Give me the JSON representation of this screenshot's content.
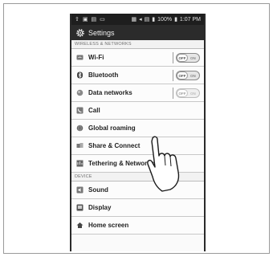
{
  "statusbar": {
    "left_icons": [
      "upload-icon",
      "image-icon",
      "sim-icon",
      "voicemail-icon"
    ],
    "battery": "100%",
    "time": "1:07 PM"
  },
  "header": {
    "title": "Settings"
  },
  "sections": {
    "wireless": "WIRELESS & NETWORKS",
    "device": "DEVICE"
  },
  "items": {
    "wifi": {
      "label": "Wi-Fi",
      "toggle_off": "OFF",
      "toggle_on": "ON"
    },
    "bluetooth": {
      "label": "Bluetooth",
      "toggle_off": "OFF",
      "toggle_on": "ON"
    },
    "data": {
      "label": "Data networks",
      "toggle_off": "OFF",
      "toggle_on": "ON"
    },
    "call": {
      "label": "Call"
    },
    "roaming": {
      "label": "Global roaming"
    },
    "share": {
      "label": "Share & Connect"
    },
    "tethering": {
      "label": "Tethering & Networks"
    },
    "sound": {
      "label": "Sound"
    },
    "display": {
      "label": "Display"
    },
    "home": {
      "label": "Home screen"
    }
  }
}
